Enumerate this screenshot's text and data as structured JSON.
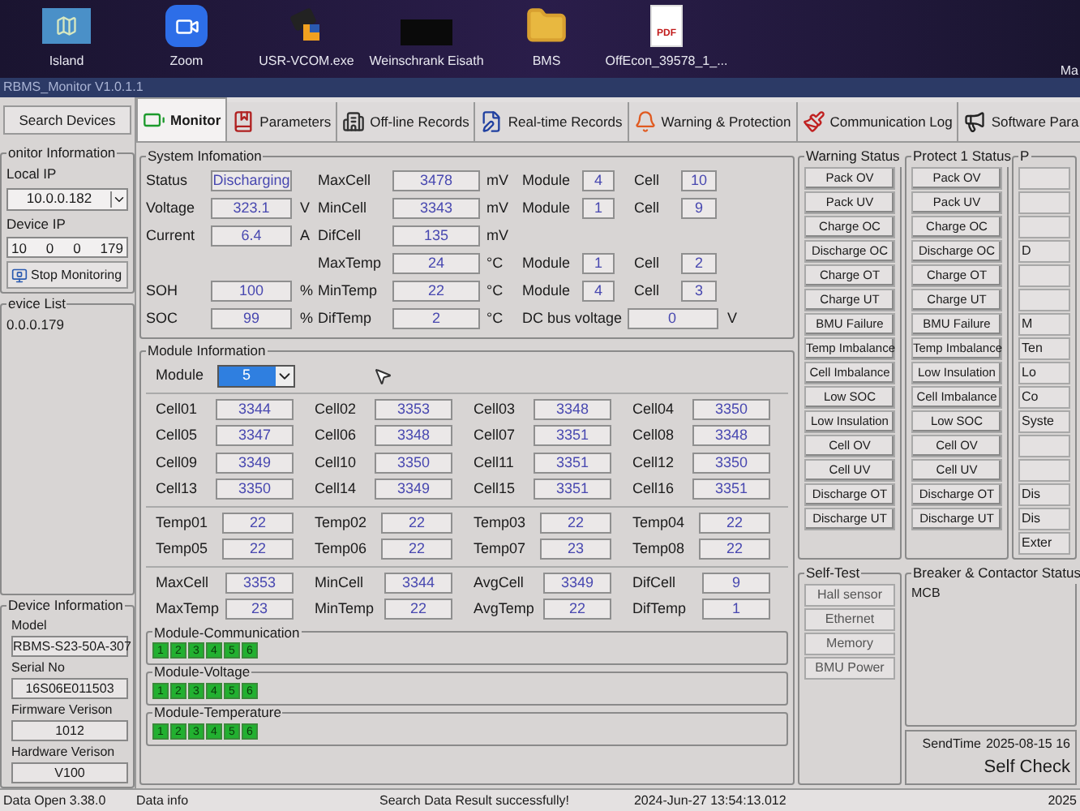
{
  "desktop": {
    "icons": [
      {
        "kind": "map",
        "label": "Island"
      },
      {
        "kind": "video",
        "label": "Zoom"
      },
      {
        "kind": "app",
        "label": "USR-VCOM.exe"
      },
      {
        "kind": "thumbnail",
        "label": "Weinschrank Eisath"
      },
      {
        "kind": "folder",
        "label": "BMS"
      },
      {
        "kind": "pdf",
        "badge": "PDF",
        "label": "OffEcon_39578_1_..."
      }
    ],
    "edge_label": "Ma"
  },
  "window": {
    "title": "RBMS_Monitor V1.0.1.1"
  },
  "search_button": "Search Devices",
  "tabs": [
    {
      "label": "Monitor",
      "selected": true
    },
    {
      "label": "Parameters",
      "selected": false
    },
    {
      "label": "Off-line Records",
      "selected": false
    },
    {
      "label": "Real-time Records",
      "selected": false
    },
    {
      "label": "Warning & Protection",
      "selected": false
    },
    {
      "label": "Communication Log",
      "selected": false
    },
    {
      "label": "Software Para",
      "selected": false
    }
  ],
  "monitor_information": {
    "title": "onitor Information",
    "local_ip_label": "Local IP",
    "local_ip": "10.0.0.182",
    "device_ip_label": "Device IP",
    "device_ip": [
      "10",
      "0",
      "0",
      "179"
    ],
    "stop_button": "Stop Monitoring"
  },
  "device_list": {
    "title": "evice List",
    "items": [
      "0.0.0.179"
    ]
  },
  "device_information": {
    "title": "Device Information",
    "fields": [
      {
        "label": "Model",
        "value": "RBMS-S23-50A-307"
      },
      {
        "label": "Serial No",
        "value": "16S06E011503"
      },
      {
        "label": "Firmware Verison",
        "value": "1012"
      },
      {
        "label": "Hardware Verison",
        "value": "V100"
      }
    ]
  },
  "system_info": {
    "title": "System Infomation",
    "rows": [
      {
        "left": {
          "label": "Status",
          "value": "Discharging"
        },
        "mid": {
          "label": "MaxCell",
          "value": "3478",
          "unit": "mV"
        },
        "loc": {
          "kind": "location",
          "module_label": "Module",
          "module": "4",
          "cell_label": "Cell",
          "cell": "10"
        }
      },
      {
        "left": {
          "label": "Voltage",
          "value": "323.1",
          "unit": "V"
        },
        "mid": {
          "label": "MinCell",
          "value": "3343",
          "unit": "mV"
        },
        "loc": {
          "kind": "location",
          "module_label": "Module",
          "module": "1",
          "cell_label": "Cell",
          "cell": "9"
        }
      },
      {
        "left": {
          "label": "Current",
          "value": "6.4",
          "unit": "A"
        },
        "mid": {
          "label": "DifCell",
          "value": "135",
          "unit": "mV"
        }
      },
      {
        "mid": {
          "label": "MaxTemp",
          "value": "24",
          "unit": "°C"
        },
        "loc": {
          "kind": "location",
          "module_label": "Module",
          "module": "1",
          "cell_label": "Cell",
          "cell": "2"
        }
      },
      {
        "left": {
          "label": "SOH",
          "value": "100",
          "unit": "%"
        },
        "mid": {
          "label": "MinTemp",
          "value": "22",
          "unit": "°C"
        },
        "loc": {
          "kind": "location",
          "module_label": "Module",
          "module": "4",
          "cell_label": "Cell",
          "cell": "3"
        }
      },
      {
        "left": {
          "label": "SOC",
          "value": "99",
          "unit": "%"
        },
        "mid": {
          "label": "DifTemp",
          "value": "2",
          "unit": "°C"
        },
        "loc": {
          "kind": "reading",
          "label": "DC bus voltage",
          "value": "0",
          "unit": "V"
        }
      }
    ]
  },
  "module_info": {
    "title": "Module Information",
    "module_label": "Module",
    "module": "5",
    "cells": [
      {
        "label": "Cell01",
        "value": "3344"
      },
      {
        "label": "Cell02",
        "value": "3353"
      },
      {
        "label": "Cell03",
        "value": "3348"
      },
      {
        "label": "Cell04",
        "value": "3350"
      },
      {
        "label": "Cell05",
        "value": "3347"
      },
      {
        "label": "Cell06",
        "value": "3348"
      },
      {
        "label": "Cell07",
        "value": "3351"
      },
      {
        "label": "Cell08",
        "value": "3348"
      },
      {
        "label": "Cell09",
        "value": "3349"
      },
      {
        "label": "Cell10",
        "value": "3350"
      },
      {
        "label": "Cell11",
        "value": "3351"
      },
      {
        "label": "Cell12",
        "value": "3350"
      },
      {
        "label": "Cell13",
        "value": "3350"
      },
      {
        "label": "Cell14",
        "value": "3349"
      },
      {
        "label": "Cell15",
        "value": "3351"
      },
      {
        "label": "Cell16",
        "value": "3351"
      }
    ],
    "temps": [
      {
        "label": "Temp01",
        "value": "22"
      },
      {
        "label": "Temp02",
        "value": "22"
      },
      {
        "label": "Temp03",
        "value": "22"
      },
      {
        "label": "Temp04",
        "value": "22"
      },
      {
        "label": "Temp05",
        "value": "22"
      },
      {
        "label": "Temp06",
        "value": "22"
      },
      {
        "label": "Temp07",
        "value": "23"
      },
      {
        "label": "Temp08",
        "value": "22"
      }
    ],
    "stats": [
      {
        "label": "MaxCell",
        "value": "3353"
      },
      {
        "label": "MinCell",
        "value": "3344"
      },
      {
        "label": "AvgCell",
        "value": "3349"
      },
      {
        "label": "DifCell",
        "value": "9"
      },
      {
        "label": "MaxTemp",
        "value": "23"
      },
      {
        "label": "MinTemp",
        "value": "22"
      },
      {
        "label": "AvgTemp",
        "value": "22"
      },
      {
        "label": "DifTemp",
        "value": "1"
      }
    ]
  },
  "module_status": [
    {
      "title": "Module-Communication",
      "modules": [
        {
          "label": "1",
          "ok": true
        },
        {
          "label": "2",
          "ok": true
        },
        {
          "label": "3",
          "ok": true
        },
        {
          "label": "4",
          "ok": true
        },
        {
          "label": "5",
          "ok": true
        },
        {
          "label": "6",
          "ok": true
        }
      ]
    },
    {
      "title": "Module-Voltage",
      "modules": [
        {
          "label": "1",
          "ok": true
        },
        {
          "label": "2",
          "ok": true
        },
        {
          "label": "3",
          "ok": true
        },
        {
          "label": "4",
          "ok": true
        },
        {
          "label": "5",
          "ok": true
        },
        {
          "label": "6",
          "ok": true
        }
      ]
    },
    {
      "title": "Module-Temperature",
      "modules": [
        {
          "label": "1",
          "ok": true
        },
        {
          "label": "2",
          "ok": true
        },
        {
          "label": "3",
          "ok": true
        },
        {
          "label": "4",
          "ok": true
        },
        {
          "label": "5",
          "ok": true
        },
        {
          "label": "6",
          "ok": true
        }
      ]
    }
  ],
  "warning_status": {
    "title": "Warning Status",
    "items": [
      "Pack OV",
      "Pack UV",
      "Charge OC",
      "Discharge OC",
      "Charge OT",
      "Charge UT",
      "BMU Failure",
      "Temp Imbalance",
      "Cell Imbalance",
      "Low SOC",
      "Low Insulation",
      "Cell OV",
      "Cell UV",
      "Discharge OT",
      "Discharge UT"
    ]
  },
  "protect_1_status": {
    "title": "Protect 1 Status",
    "items": [
      "Pack OV",
      "Pack UV",
      "Charge OC",
      "Discharge OC",
      "Charge OT",
      "Charge UT",
      "BMU Failure",
      "Temp Imbalance",
      "Low Insulation",
      "Cell Imbalance",
      "Low SOC",
      "Cell OV",
      "Cell UV",
      "Discharge OT",
      "Discharge UT"
    ]
  },
  "protect_2_status": {
    "title": "P",
    "items": [
      {
        "kind": "blank"
      },
      {
        "kind": "blank"
      },
      {
        "kind": "blank"
      },
      {
        "kind": "label",
        "text": "D"
      },
      {
        "kind": "blank"
      },
      {
        "kind": "blank"
      },
      {
        "kind": "label",
        "text": "M"
      },
      {
        "kind": "label",
        "text": "Ten"
      },
      {
        "kind": "label",
        "text": "Lo"
      },
      {
        "kind": "label",
        "text": "Co"
      },
      {
        "kind": "label",
        "text": "Syste"
      },
      {
        "kind": "blank"
      },
      {
        "kind": "blank"
      },
      {
        "kind": "label",
        "text": "Dis"
      },
      {
        "kind": "label",
        "text": "Dis"
      },
      {
        "kind": "label",
        "text": "Exter"
      }
    ]
  },
  "self_test": {
    "title": "Self-Test",
    "items": [
      "Hall sensor",
      "Ethernet",
      "Memory",
      "BMU Power"
    ]
  },
  "breaker_status": {
    "title": "Breaker & Contactor Status",
    "items": [
      "MCB"
    ]
  },
  "send_info": {
    "label": "SendTime",
    "time": "2025-08-15 16",
    "button": "Self Check"
  },
  "status_bar": {
    "items": [
      "Data Open 3.38.0",
      "Data info",
      "Search Data Result successfully!",
      "2024-Jun-27 13:54:13.012",
      "2025"
    ]
  }
}
